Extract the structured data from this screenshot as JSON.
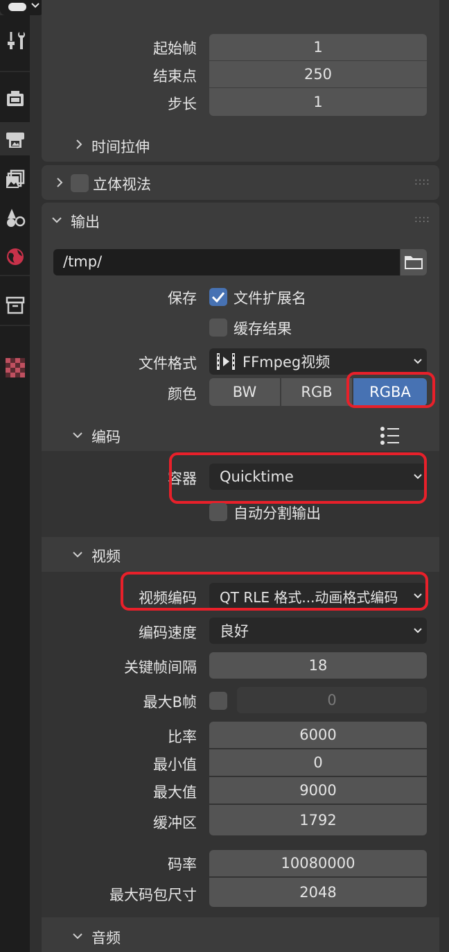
{
  "frame_range": {
    "start_label": "起始帧",
    "start_value": "1",
    "end_label": "结束点",
    "end_value": "250",
    "step_label": "步长",
    "step_value": "1",
    "time_stretch_label": "时间拉伸"
  },
  "stereoscopy": {
    "label": "立体视法",
    "enabled": false
  },
  "output": {
    "title": "输出",
    "path": "/tmp/",
    "save_label": "保存",
    "file_extensions_label": "文件扩展名",
    "file_extensions_checked": true,
    "cache_result_label": "缓存结果",
    "cache_result_checked": false,
    "file_format_label": "文件格式",
    "file_format_value": "FFmpeg视频",
    "color_label": "颜色",
    "color_modes": [
      "BW",
      "RGB",
      "RGBA"
    ],
    "color_selected": "RGBA"
  },
  "encoding": {
    "title": "编码",
    "container_label": "容器",
    "container_value": "Quicktime",
    "autosplit_label": "自动分割输出",
    "autosplit_checked": false
  },
  "video": {
    "title": "视频",
    "codec_label": "视频编码",
    "codec_value": "QT RLE 格式...动画格式编码",
    "speed_label": "编码速度",
    "speed_value": "良好",
    "keyframe_label": "关键帧间隔",
    "keyframe_value": "18",
    "max_b_label": "最大B帧",
    "max_b_checked": false,
    "max_b_value": "0",
    "bitrate_label": "比率",
    "bitrate_value": "6000",
    "min_label": "最小值",
    "min_value": "0",
    "max_label": "最大值",
    "max_value": "9000",
    "buffer_label": "缓冲区",
    "buffer_value": "1792",
    "mux_rate_label": "码率",
    "mux_rate_value": "10080000",
    "mux_packet_label": "最大码包尺寸",
    "mux_packet_value": "2048"
  },
  "audio": {
    "title": "音频"
  },
  "tabs": [
    "tool-icon",
    "render-icon",
    "output-icon",
    "view-layer-icon",
    "scene-icon",
    "world-icon",
    "collection-icon",
    "texture-icon"
  ],
  "colors": {
    "accent": "#4772b3",
    "highlight_box": "#e8202a",
    "background": "#303030",
    "panel": "#3c3c3c"
  }
}
